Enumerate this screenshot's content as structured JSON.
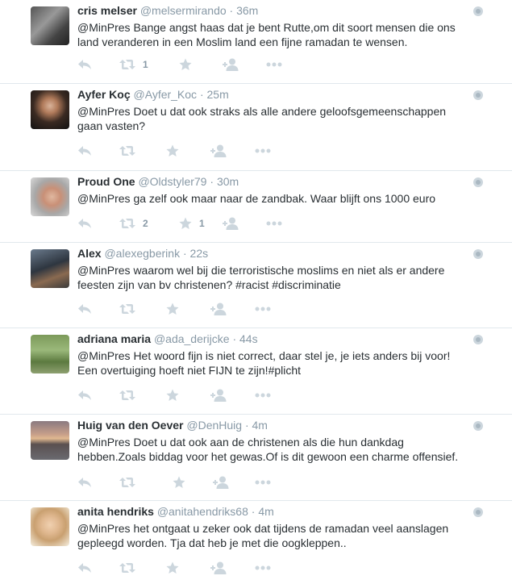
{
  "colors": {
    "icon": "#ccd6dd",
    "muted": "#8899a6",
    "text": "#292f33",
    "border": "#e1e8ed"
  },
  "tweets": [
    {
      "name": "cris melser",
      "handle": "@melsermirando",
      "time": "36m",
      "text": "@MinPres Bange angst haas dat je bent Rutte,om dit soort mensen die ons land veranderen in een Moslim land een fijne ramadan te wensen.",
      "retweets": "1",
      "favorites": ""
    },
    {
      "name": "Ayfer Koç",
      "handle": "@Ayfer_Koc",
      "time": "25m",
      "text": "@MinPres Doet u dat ook straks als alle andere geloofsgemeenschappen gaan vasten?",
      "retweets": "",
      "favorites": ""
    },
    {
      "name": "Proud One",
      "handle": "@Oldstyler79",
      "time": "30m",
      "text": "@MinPres ga zelf ook maar naar de zandbak. Waar blijft ons 1000 euro",
      "retweets": "2",
      "favorites": "1"
    },
    {
      "name": "Alex",
      "handle": "@alexegberink",
      "time": "22s",
      "text": "@MinPres waarom wel bij die terroristische moslims en niet als er andere feesten zijn van bv christenen? #racist #discriminatie",
      "retweets": "",
      "favorites": ""
    },
    {
      "name": "adriana maria",
      "handle": "@ada_derijcke",
      "time": "44s",
      "text": "@MinPres Het woord fijn is niet correct, daar stel je, je iets anders bij voor! Een overtuiging hoeft niet FIJN te zijn!#plicht",
      "retweets": "",
      "favorites": ""
    },
    {
      "name": "Huig van den Oever",
      "handle": "@DenHuig",
      "time": "4m",
      "text": "@MinPres Doet u dat ook aan de christenen als die hun dankdag hebben.Zoals biddag voor het gewas.Of is dit gewoon een charme offensief.",
      "retweets": "",
      "favorites": ""
    },
    {
      "name": "anita hendriks",
      "handle": "@anitahendriks68",
      "time": "4m",
      "text": "@MinPres het ontgaat u zeker ook dat tijdens de ramadan veel aanslagen gepleegd worden. Tja dat heb je met die oogkleppen..",
      "retweets": "",
      "favorites": ""
    }
  ]
}
